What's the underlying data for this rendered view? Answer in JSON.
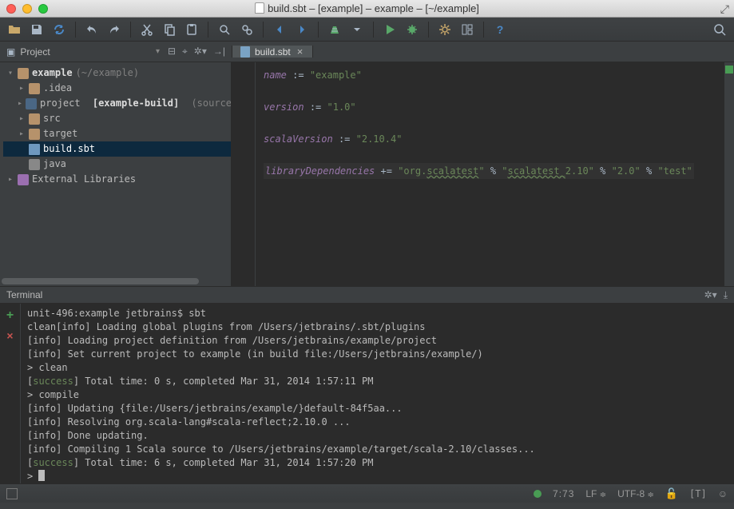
{
  "titlebar": {
    "title": "build.sbt – [example] – example – [~/example]"
  },
  "navbar": {
    "project_label": "Project"
  },
  "tabs": [
    {
      "label": "build.sbt"
    }
  ],
  "tree": {
    "root": {
      "name": "example",
      "hint": "(~/example)"
    },
    "items": [
      {
        "name": ".idea",
        "kind": "folder"
      },
      {
        "name": "project",
        "bold": "[example-build]",
        "hint": "(sources root)",
        "kind": "mod"
      },
      {
        "name": "src",
        "kind": "folder"
      },
      {
        "name": "target",
        "kind": "folder"
      },
      {
        "name": "build.sbt",
        "kind": "file",
        "selected": true
      },
      {
        "name": "java",
        "kind": "java",
        "noarrow": true
      }
    ],
    "external": "External Libraries"
  },
  "code": {
    "l1_key": "name",
    "l1_op": ":=",
    "l1_str": "\"example\"",
    "l2_key": "version",
    "l2_op": ":=",
    "l2_str": "\"1.0\"",
    "l3_key": "scalaVersion",
    "l3_op": ":=",
    "l3_str": "\"2.10.4\"",
    "l4_key": "libraryDependencies",
    "l4_op": "+=",
    "l4_s1a": "\"org.",
    "l4_s1b": "scalatest",
    "l4_s1c": "\"",
    "l4_pct": "%",
    "l4_s2a": "\"",
    "l4_s2b": "scalatest_",
    "l4_s2c": "2.10\"",
    "l4_s3": "\"2.0\"",
    "l4_s4": "\"test\""
  },
  "terminal": {
    "title": "Terminal",
    "lines": [
      {
        "t": "unit-496:example jetbrains$ sbt"
      },
      {
        "t": "clean[info] Loading global plugins from /Users/jetbrains/.sbt/plugins"
      },
      {
        "t": "[info] Loading project definition from /Users/jetbrains/example/project"
      },
      {
        "t": "[info] Set current project to example (in build file:/Users/jetbrains/example/)"
      },
      {
        "t": "> clean"
      },
      {
        "pre": "[",
        "success": "success",
        "post": "] Total time: 0 s, completed Mar 31, 2014 1:57:11 PM"
      },
      {
        "t": "> compile"
      },
      {
        "t": "[info] Updating {file:/Users/jetbrains/example/}default-84f5aa..."
      },
      {
        "t": "[info] Resolving org.scala-lang#scala-reflect;2.10.0 ..."
      },
      {
        "t": "[info] Done updating."
      },
      {
        "t": "[info] Compiling 1 Scala source to /Users/jetbrains/example/target/scala-2.10/classes..."
      },
      {
        "pre": "[",
        "success": "success",
        "post": "] Total time: 6 s, completed Mar 31, 2014 1:57:20 PM"
      },
      {
        "t": "> ",
        "cursor": true
      }
    ]
  },
  "status": {
    "linecol": "7:73",
    "line_sep": "LF",
    "encoding": "UTF-8",
    "term": "[T]"
  }
}
